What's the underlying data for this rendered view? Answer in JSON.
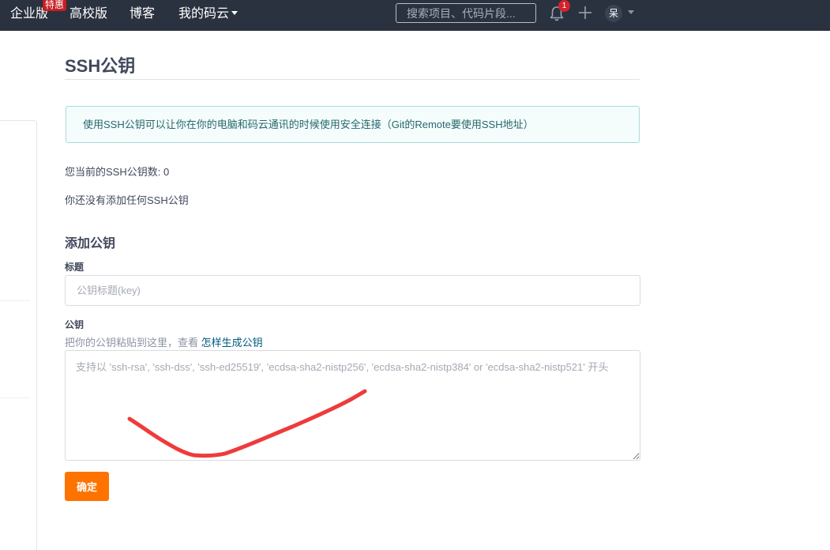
{
  "nav": {
    "enterprise": "企业版",
    "promo_badge": "特惠",
    "edu": "高校版",
    "blog": "博客",
    "mine": "我的码云",
    "search_placeholder": "搜索项目、代码片段...",
    "notification_count": "1",
    "avatar_text": "呆"
  },
  "page": {
    "title": "SSH公钥",
    "info_text": "使用SSH公钥可以让你在你的电脑和码云通讯的时候使用安全连接（Git的Remote要使用SSH地址）",
    "key_count_text": "您当前的SSH公钥数: 0",
    "empty_text": "你还没有添加任何SSH公钥"
  },
  "form": {
    "section_title": "添加公钥",
    "title_label": "标题",
    "title_placeholder": "公钥标题(key)",
    "key_label": "公钥",
    "key_help": "把你的公钥粘贴到这里，查看",
    "key_help_link": "怎样生成公钥",
    "key_placeholder": "支持以 'ssh-rsa', 'ssh-dss', 'ssh-ed25519', 'ecdsa-sha2-nistp256', 'ecdsa-sha2-nistp384' or 'ecdsa-sha2-nistp521' 开头",
    "submit_label": "确定"
  },
  "colors": {
    "nav_bg": "#2a313f",
    "accent_orange": "#fe7300",
    "badge_red": "#c71d23",
    "info_border": "#a9dadb",
    "info_bg": "#f4fcfc",
    "annotation_red": "#ee3b3b"
  },
  "icons": {
    "notifications": "bell-icon",
    "create": "plus-icon",
    "user_menu": "chevron-down-icon"
  }
}
